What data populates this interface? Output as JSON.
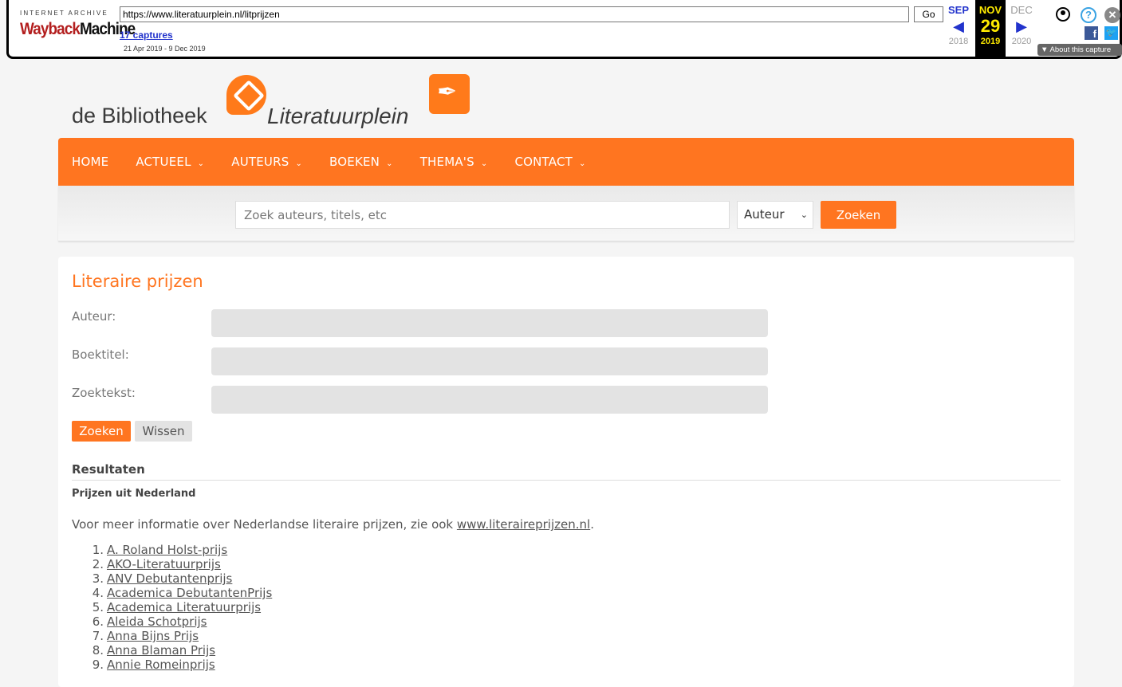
{
  "wayback": {
    "ia_text": "INTERNET ARCHIVE",
    "logo_part1": "Wayback",
    "logo_part2": "Machine",
    "url": "https://www.literatuurplein.nl/litprijzen",
    "go_label": "Go",
    "captures": "17 captures",
    "range": "21 Apr 2019 - 9 Dec 2019",
    "prev_month": "SEP",
    "cur_month": "NOV",
    "next_month": "DEC",
    "day": "29",
    "prev_year": "2018",
    "cur_year": "2019",
    "next_year": "2020",
    "about": "About this capture"
  },
  "site": {
    "logo_bib": "de Bibliotheek",
    "logo_lit": "Literatuurplein",
    "nav": [
      "HOME",
      "ACTUEEL",
      "AUTEURS",
      "BOEKEN",
      "THEMA'S",
      "CONTACT"
    ],
    "search_placeholder": "Zoek auteurs, titels, etc",
    "search_select": "Auteur",
    "search_button": "Zoeken"
  },
  "panel": {
    "title": "Literaire prijzen",
    "label_auteur": "Auteur:",
    "label_boektitel": "Boektitel:",
    "label_zoektekst": "Zoektekst:",
    "btn_zoeken": "Zoeken",
    "btn_wissen": "Wissen",
    "results_heading": "Resultaten",
    "results_sub": "Prijzen uit Nederland",
    "info_text": "Voor meer informatie over Nederlandse literaire prijzen, zie ook ",
    "info_link": "www.literaireprijzen.nl",
    "info_end": ".",
    "prizes": [
      "A. Roland Holst-prijs",
      "AKO-Literatuurprijs",
      "ANV Debutantenprijs",
      "Academica DebutantenPrijs",
      "Academica Literatuurprijs",
      "Aleida Schotprijs",
      "Anna Bijns Prijs",
      "Anna Blaman Prijs",
      "Annie Romeinprijs"
    ]
  }
}
